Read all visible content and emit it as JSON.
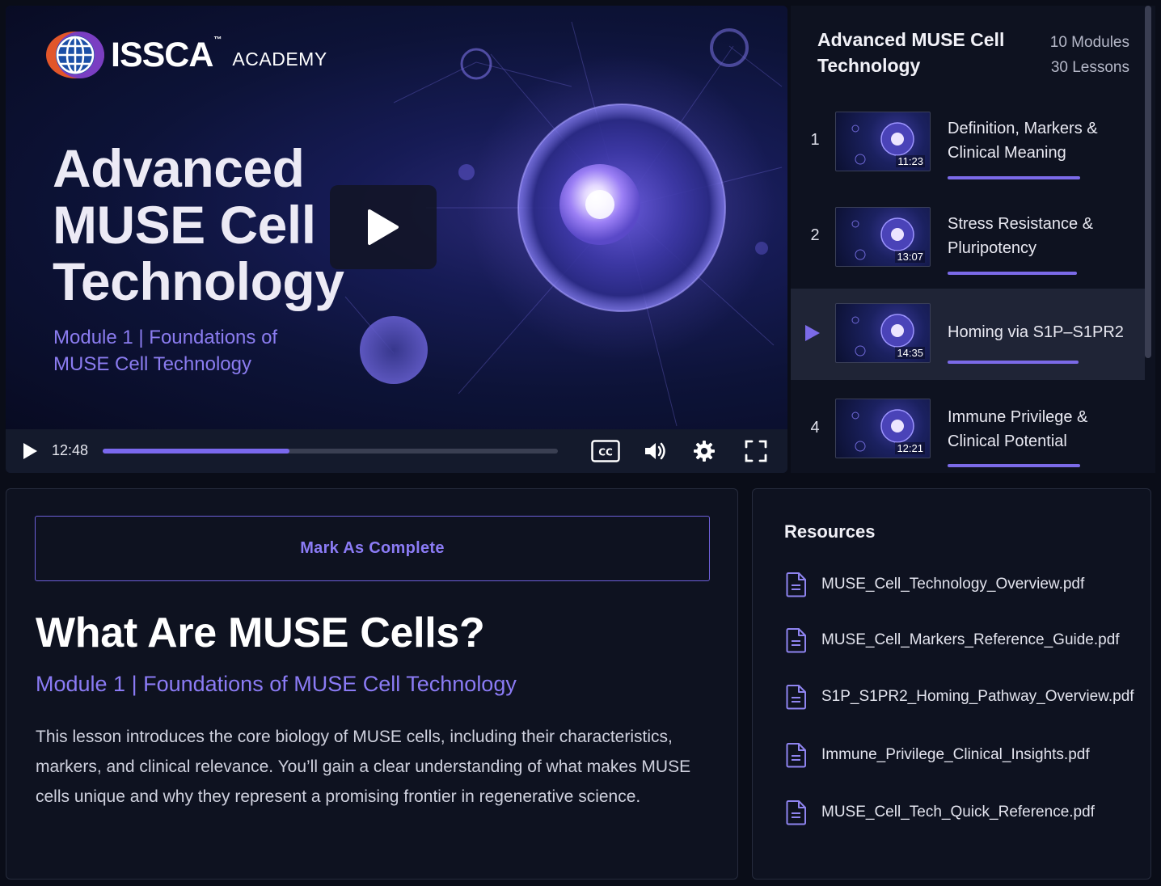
{
  "brand": {
    "name": "ISSCA",
    "tm": "™",
    "sub": "ACADEMY"
  },
  "video": {
    "hero_title_lines": [
      "Advanced",
      "MUSE Cell",
      "Technology"
    ],
    "hero_subtitle": "Module 1 | Foundations of MUSE Cell Technology",
    "current_time": "12:48",
    "progress": 0.41
  },
  "playlist": {
    "title": "Advanced MUSE Cell Technology",
    "modules": "10 Modules",
    "lessons_count": "30 Lessons",
    "lessons": [
      {
        "number": "1",
        "title": "Definition, Markers & Clinical Meaning",
        "duration": "11:23",
        "active": false
      },
      {
        "number": "2",
        "title": "Stress Resistance & Pluripotency",
        "duration": "13:07",
        "active": false
      },
      {
        "number": "",
        "title": "Homing via S1P–S1PR2",
        "duration": "14:35",
        "active": true
      },
      {
        "number": "4",
        "title": "Immune Privilege & Clinical Potential",
        "duration": "12:21",
        "active": false
      }
    ]
  },
  "lesson": {
    "complete_label": "Mark As Complete",
    "title": "What Are MUSE Cells?",
    "subtitle": "Module 1 | Foundations of MUSE Cell Technology",
    "description": "This lesson introduces the core biology of MUSE cells, including their characteristics, markers, and clinical relevance. You’ll gain a clear understanding of what makes MUSE cells unique and why they represent a promising frontier in regenerative science."
  },
  "resources": {
    "title": "Resources",
    "files": [
      "MUSE_Cell_Technology_Overview.pdf",
      "MUSE_Cell_Markers_Reference_Guide.pdf",
      "S1P_S1PR2_Homing_Pathway_Overview.pdf",
      "Immune_Privilege_Clinical_Insights.pdf",
      "MUSE_Cell_Tech_Quick_Reference.pdf"
    ]
  },
  "icons": {
    "play": "play-icon",
    "cc": "closed-captions-icon",
    "volume": "volume-icon",
    "settings": "gear-icon",
    "fullscreen": "fullscreen-icon",
    "file": "document-icon"
  },
  "colors": {
    "accent": "#7b6ae8",
    "accent_text": "#8b7bf5",
    "panel": "#0e1220",
    "background": "#0a0d18"
  }
}
